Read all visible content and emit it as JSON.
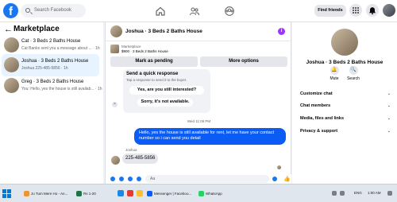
{
  "topbar": {
    "logo": "f",
    "search_placeholder": "Search Facebook",
    "find_friends": "Find friends"
  },
  "left": {
    "back": "←",
    "title": "Marketplace",
    "conversations": [
      {
        "name": "Cat · 3 Beds 2 Baths House",
        "snippet": "Cat Banks sent you a message about ... · 1h"
      },
      {
        "name": "Joshua · 3 Beds 2 Baths House",
        "snippet": "Joshua 225-485-5856 · 1h"
      },
      {
        "name": "Greg · 3 Beds 2 Baths House",
        "snippet": "You: Hello, yes the house is still availab... · 1h"
      }
    ]
  },
  "chat": {
    "title": "Joshua · 3 Beds 2 Baths House",
    "info": "i",
    "listing_tag": "Marketplace",
    "listing_price": "$900 · 3 Beds 2 Baths House",
    "mark_pending": "Mark as pending",
    "more_options": "More options",
    "quick_title": "Send a quick response",
    "quick_sub": "Tap a response to send it to the buyer.",
    "quick_close": "×",
    "quick_1": "Yes, are you still interested?",
    "quick_2": "Sorry, it's not available.",
    "timestamp": "Wed 11:09 PM",
    "outgoing": "Hello, yes the house is still available for rent, let me have your contact number so i can send you detail",
    "incoming_name": "Joshua",
    "incoming": "225-485-5856",
    "composer_placeholder": "Aa",
    "like": "👍"
  },
  "right": {
    "name": "Joshua · 3 Beds 2 Baths House",
    "mute": "Mute",
    "search": "Search",
    "rows": [
      "Customize chat",
      "Chat members",
      "Media, files and links",
      "Privacy & support"
    ],
    "chevron": "⌄"
  },
  "taskbar": {
    "item1": "Jo Tum Mere Ho - An...",
    "item2": "Rs 1-20",
    "item3": "Messenger | Faceboo...",
    "item4": "WhatsApp",
    "lang": "ENG",
    "time": "1:00 AM"
  },
  "colors": {
    "accent": "#1877f2",
    "outgoing": "#0a5cf5",
    "info": "#a033ff"
  }
}
